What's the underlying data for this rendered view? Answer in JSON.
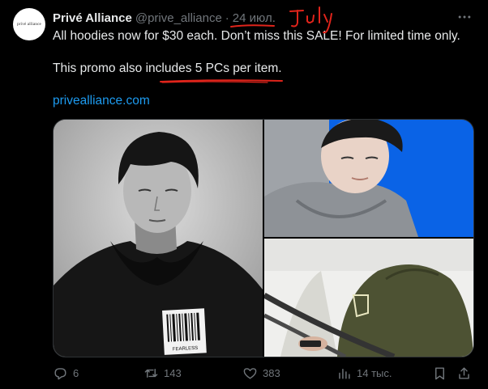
{
  "author": {
    "name": "Privé Alliance",
    "handle": "@prive_alliance",
    "separator": "·",
    "date": "24 июл.",
    "avatar_text": "privé alliance"
  },
  "tweet": {
    "line1": "All hoodies now for $30 each. Don’t miss this SALE! For limited time only.",
    "line2": "This promo also includes 5 PCs per item.",
    "link": "privealliance.com"
  },
  "annotation": {
    "handwritten_text": "July",
    "color": "#e0241b"
  },
  "media": {
    "images": [
      {
        "description": "black-and-white portrait, black hoodie, barcode tag",
        "tag_text": "FEARLESS"
      },
      {
        "description": "close-up portrait, grey hoodie, blue background"
      },
      {
        "description": "olive green hoodie, railing"
      }
    ]
  },
  "actions": {
    "replies": "6",
    "reposts": "143",
    "likes": "383",
    "views": "14 тыс."
  },
  "icons": [
    "more-icon",
    "reply-icon",
    "repost-icon",
    "like-icon",
    "views-icon",
    "bookmark-icon",
    "share-icon"
  ],
  "colors": {
    "background": "#000000",
    "text": "#e7e9ea",
    "muted": "#71767b",
    "link": "#1d9bf0"
  }
}
